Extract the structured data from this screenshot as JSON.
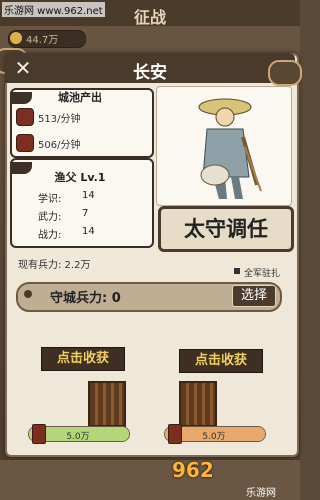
{
  "watermark": "乐游网 www.962.net",
  "top_title": "征战",
  "resource": {
    "value": "44.7万"
  },
  "modal": {
    "title": "长安",
    "close_symbol": "✕"
  },
  "production": {
    "title": "城池产出",
    "items": [
      {
        "text": "513/分钟",
        "icon": "supply-icon"
      },
      {
        "text": "506/分钟",
        "icon": "coin-bag-icon"
      }
    ]
  },
  "general": {
    "name": "渔父 Lv.1",
    "stats": [
      {
        "label": "学识:",
        "value": "14"
      },
      {
        "label": "武力:",
        "value": "7"
      },
      {
        "label": "战力:",
        "value": "14"
      }
    ]
  },
  "appoint_button": "太守调任",
  "troops": {
    "current_text": "现有兵力: 2.2万",
    "full_army_label": "全军驻扎",
    "defense_label": "守城兵力: 0",
    "select_button": "选择"
  },
  "collect": {
    "left_button": "点击收获",
    "right_button": "点击收获",
    "left_amount": "5.0万",
    "right_amount": "5.0万",
    "left_progress": 1.0,
    "right_progress": 1.0
  },
  "bottom_logo": "962",
  "bottom_logo_sub": "乐游网",
  "colors": {
    "accent": "#4a3b2d",
    "collect_text": "#f0d060"
  }
}
